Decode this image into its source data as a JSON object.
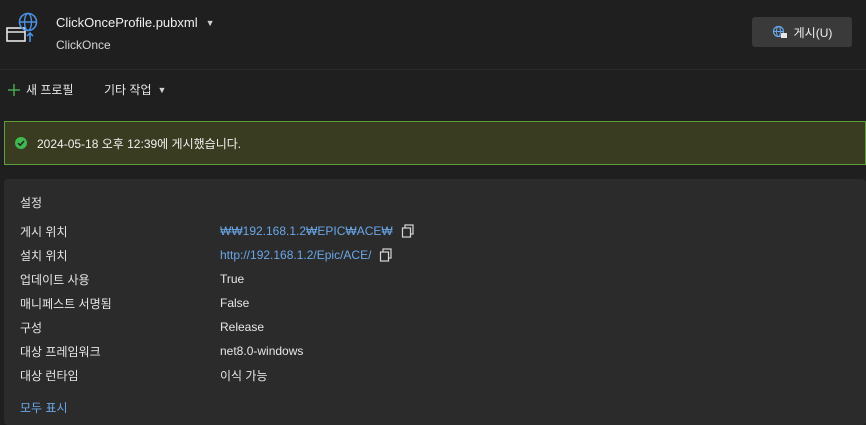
{
  "header": {
    "profile_name": "ClickOnceProfile.pubxml",
    "profile_type": "ClickOnce",
    "publish_label": "게시(U)"
  },
  "toolbar": {
    "new_profile_label": "새 프로필",
    "other_actions_label": "기타 작업"
  },
  "banner": {
    "message": "2024-05-18 오후 12:39에 게시했습니다."
  },
  "settings": {
    "title": "설정",
    "rows": [
      {
        "label": "게시 위치",
        "value": "₩₩192.168.1.2₩EPIC₩ACE₩"
      },
      {
        "label": "설치 위치",
        "value": "http://192.168.1.2/Epic/ACE/"
      },
      {
        "label": "업데이트 사용",
        "value": "True"
      },
      {
        "label": "매니페스트 서명됨",
        "value": "False"
      },
      {
        "label": "구성",
        "value": "Release"
      },
      {
        "label": "대상 프레임워크",
        "value": "net8.0-windows"
      },
      {
        "label": "대상 런타임",
        "value": "이식 가능"
      }
    ],
    "show_all_label": "모두 표시"
  },
  "colors": {
    "background": "#1f1f1f",
    "panel": "#2b2b2b",
    "banner_bg": "#393c20",
    "banner_border": "#5f9e3a",
    "success": "#3fb950",
    "link": "#6aa7e8",
    "accent_icon": "#4a90e2"
  },
  "icons": {
    "profile": "globe-window-icon",
    "publish": "publish-globe-icon",
    "new_profile": "plus-icon",
    "dropdown": "caret-down-icon",
    "success": "check-circle-icon",
    "copy": "copy-icon"
  }
}
